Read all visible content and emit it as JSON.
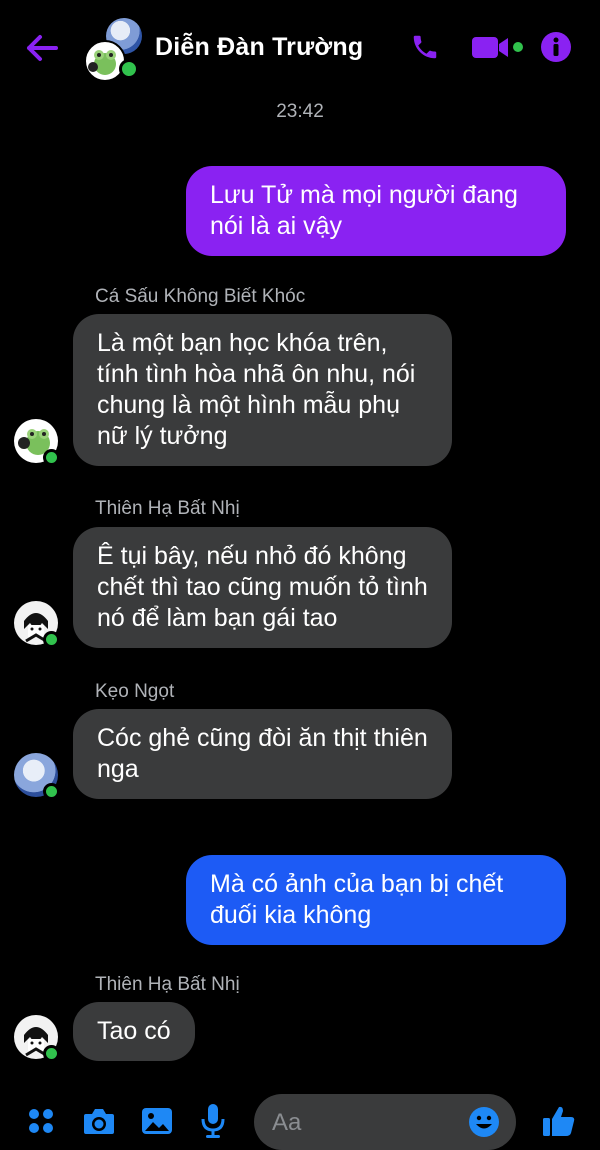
{
  "header": {
    "title": "Diễn Đàn Trường",
    "accent": "#8a22f2",
    "online_color": "#31c24d",
    "icons": [
      "back-arrow-icon",
      "phone-icon",
      "video-camera-icon",
      "info-icon"
    ]
  },
  "timestamp": "23:42",
  "messages": [
    {
      "direction": "outgoing",
      "color": "#8a22f2",
      "text": "Lưu Tử mà mọi người đang nói là ai vậy"
    },
    {
      "direction": "incoming",
      "sender": "Cá Sấu Không Biết Khóc",
      "text": "Là một bạn học khóa trên, tính tình hòa nhã ôn nhu, nói chung là một hình mẫu phụ nữ lý tưởng"
    },
    {
      "direction": "incoming",
      "sender": "Thiên Hạ Bất Nhị",
      "text": "Ê tụi bây, nếu nhỏ đó không chết thì tao cũng muốn tỏ tình nó để làm bạn gái tao"
    },
    {
      "direction": "incoming",
      "sender": "Kẹo Ngọt",
      "text": "Cóc ghẻ cũng đòi ăn thịt thiên nga"
    },
    {
      "direction": "outgoing",
      "color": "#1d5bf5",
      "text": "Mà có ảnh của bạn bị chết đuối kia không"
    },
    {
      "direction": "incoming",
      "sender": "Thiên Hạ Bất Nhị",
      "text": "Tao có"
    }
  ],
  "composer": {
    "placeholder": "Aa",
    "icons": [
      "apps-grid-icon",
      "camera-icon",
      "image-gallery-icon",
      "microphone-icon",
      "emoji-icon",
      "thumbs-up-icon"
    ]
  }
}
